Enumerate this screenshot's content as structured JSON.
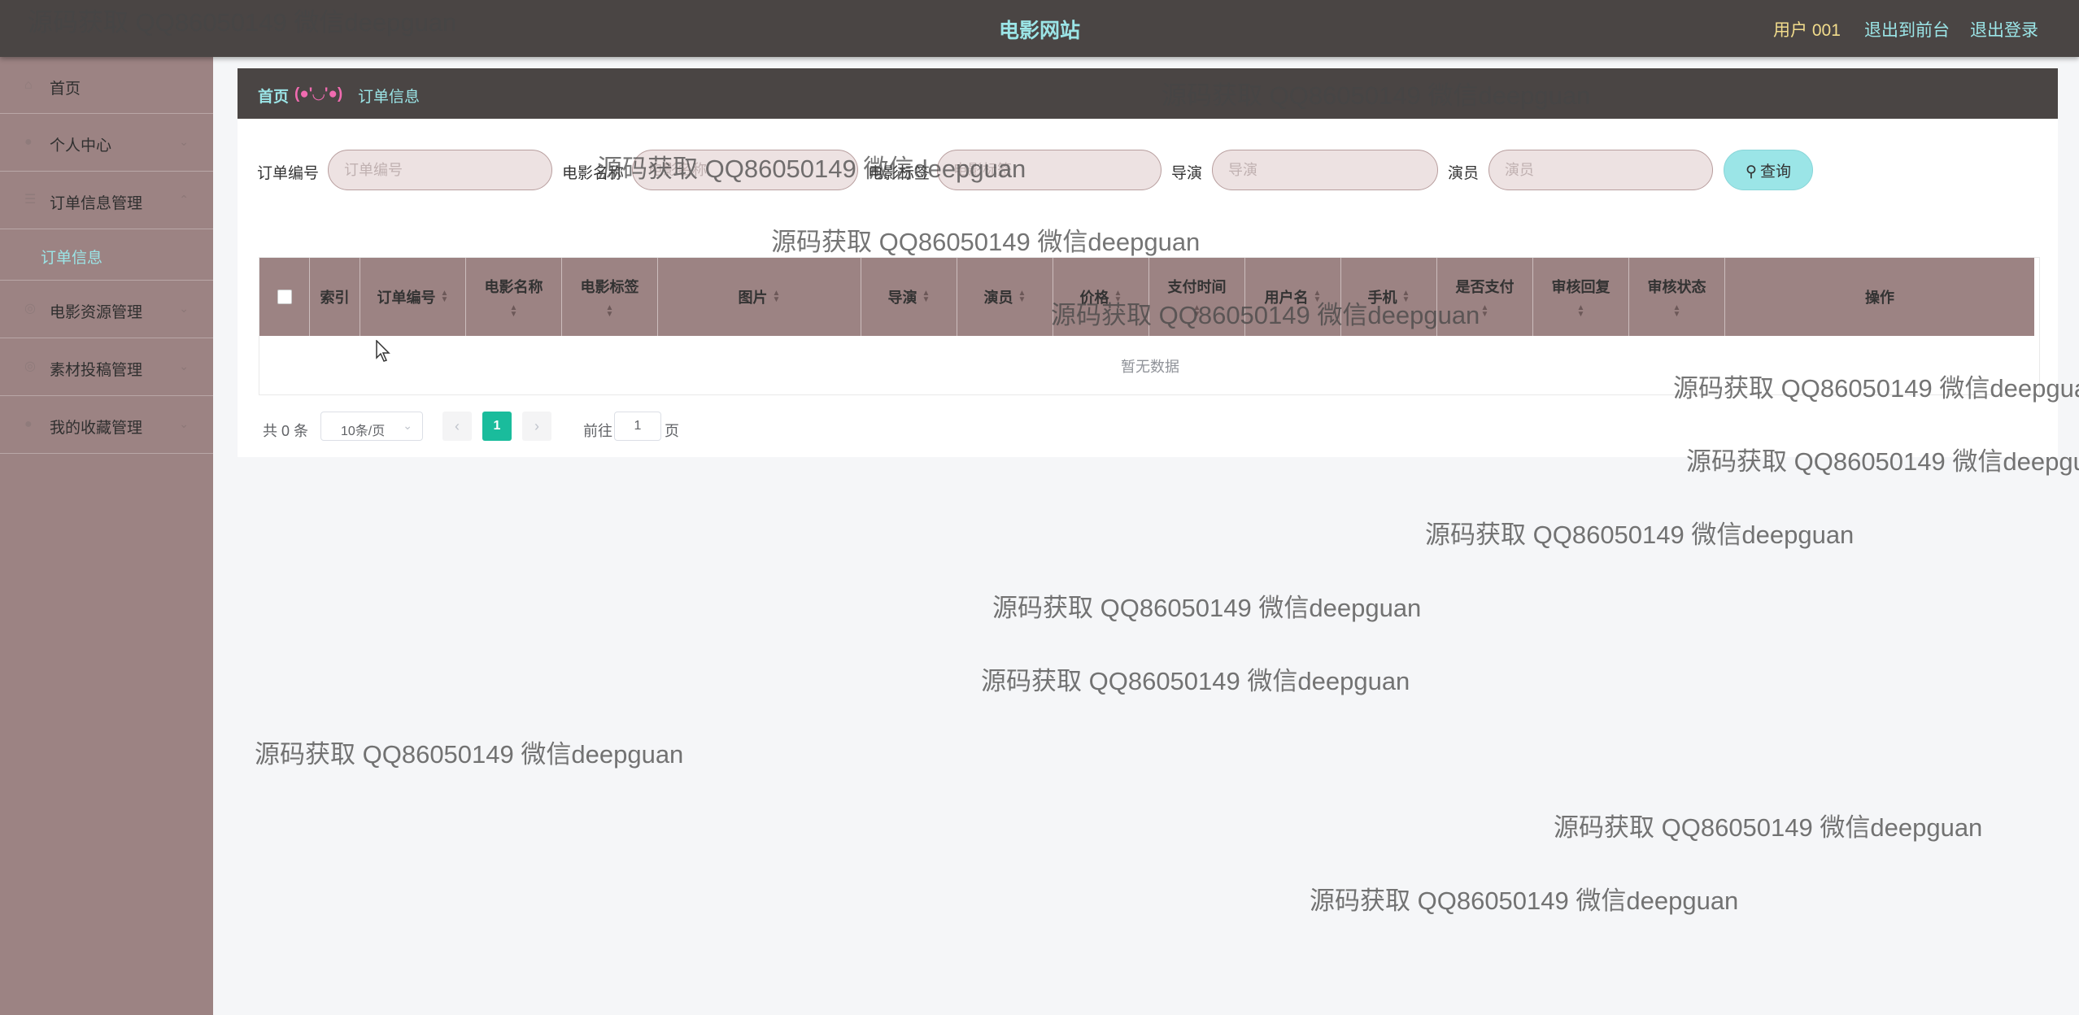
{
  "header": {
    "title": "电影网站",
    "user": "用户 001",
    "to_frontend": "退出到前台",
    "logout": "退出登录"
  },
  "sidebar": {
    "items": [
      {
        "label": "首页",
        "icon": "home-icon"
      },
      {
        "label": "个人中心",
        "icon": "user-icon"
      },
      {
        "label": "订单信息管理",
        "icon": "list-icon"
      },
      {
        "label": "订单信息",
        "icon": ""
      },
      {
        "label": "电影资源管理",
        "icon": "circle-icon"
      },
      {
        "label": "素材投稿管理",
        "icon": "circle-icon"
      },
      {
        "label": "我的收藏管理",
        "icon": "user-icon"
      }
    ]
  },
  "breadcrumb": {
    "home": "首页",
    "face": "(●'◡'●)",
    "current": "订单信息"
  },
  "filters": {
    "order_no": {
      "label": "订单编号",
      "placeholder": "订单编号"
    },
    "movie_name": {
      "label": "电影名称",
      "placeholder": "电影名称"
    },
    "movie_tag": {
      "label": "电影标签",
      "placeholder": "电影标签"
    },
    "director": {
      "label": "导演",
      "placeholder": "导演"
    },
    "actor": {
      "label": "演员",
      "placeholder": "演员"
    },
    "query_button": "查询"
  },
  "table": {
    "columns": {
      "index": "索引",
      "order_no": "订单编号",
      "movie_name": "电影名称",
      "movie_tag": "电影标签",
      "image": "图片",
      "director": "导演",
      "actor": "演员",
      "price": "价格",
      "pay_time": "支付时间",
      "username": "用户名",
      "phone": "手机",
      "is_paid": "是否支付",
      "review_reply": "审核回复",
      "review_status": "审核状态",
      "actions": "操作"
    },
    "empty_text": "暂无数据"
  },
  "pagination": {
    "total": "共 0 条",
    "page_size": "10条/页",
    "current_page": "1",
    "goto_label": "前往",
    "goto_value": "1",
    "page_suffix": "页"
  },
  "watermark": "源码获取 QQ86050149 微信deepguan",
  "colors": {
    "header_bg": "#4a4544",
    "sidebar_bg": "#9c8383",
    "accent": "#9be5e7",
    "user_text": "#f2dc8c",
    "pager_active": "#1abc9c"
  }
}
